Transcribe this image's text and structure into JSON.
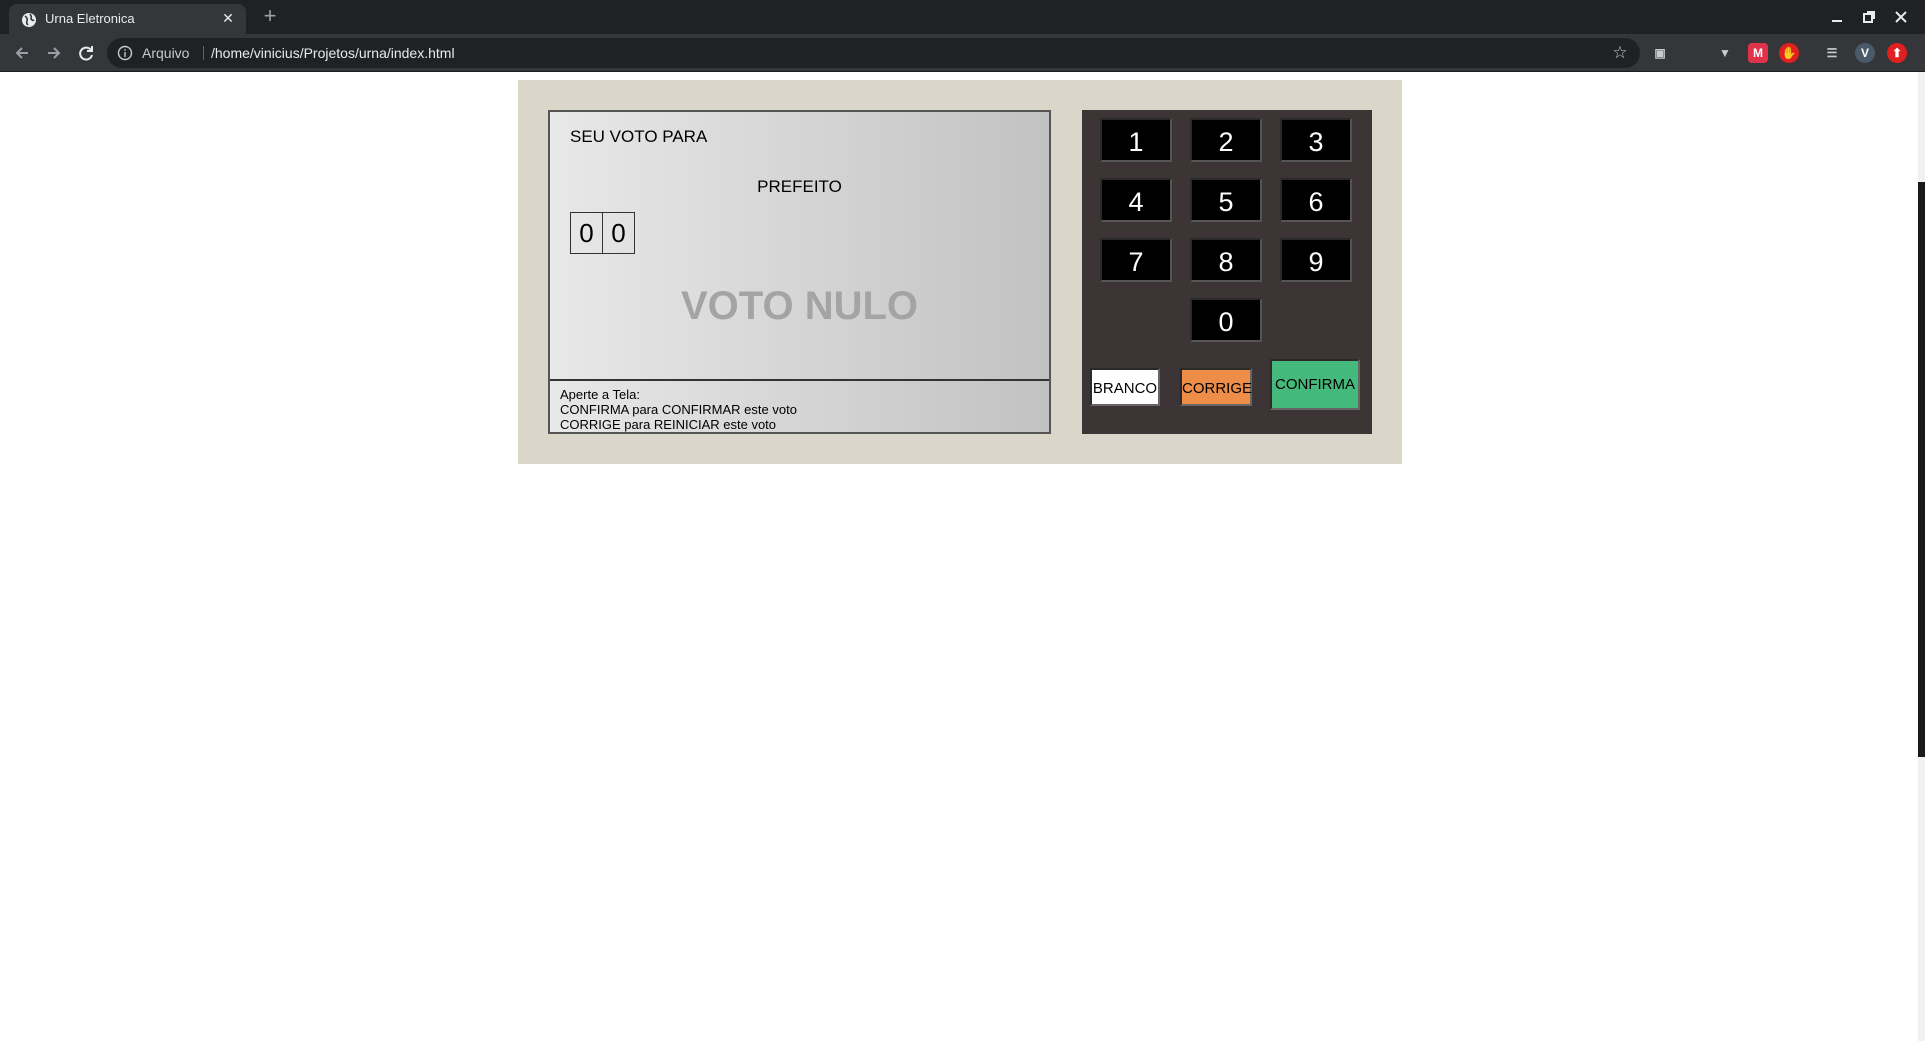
{
  "browser": {
    "tab_title": "Urna Eletronica",
    "tab_close": "✕",
    "new_tab": "+",
    "scheme_label": "Arquivo",
    "url": "/home/vinicius/Projetos/urna/index.html",
    "profile_initial": "V",
    "ext_m_label": "M"
  },
  "urna": {
    "titulo": "SEU VOTO PARA",
    "cargo": "PREFEITO",
    "digitos": [
      "0",
      "0"
    ],
    "aviso": "VOTO NULO",
    "instrucoes": {
      "linha1": "Aperte a Tela:",
      "linha2": "CONFIRMA para CONFIRMAR este voto",
      "linha3": "CORRIGE para REINICIAR este voto"
    }
  },
  "teclado": {
    "numeros": [
      "1",
      "2",
      "3",
      "4",
      "5",
      "6",
      "7",
      "8",
      "9",
      "0"
    ],
    "branco": "BRANCO",
    "corrige": "CORRIGE",
    "confirma": "CONFIRMA"
  },
  "colors": {
    "urna_bg": "#dad6ca",
    "teclado_bg": "#3d3535",
    "corrige": "#ed8d48",
    "confirma": "#45b97c",
    "voto_nulo": "#a4a4a4"
  }
}
